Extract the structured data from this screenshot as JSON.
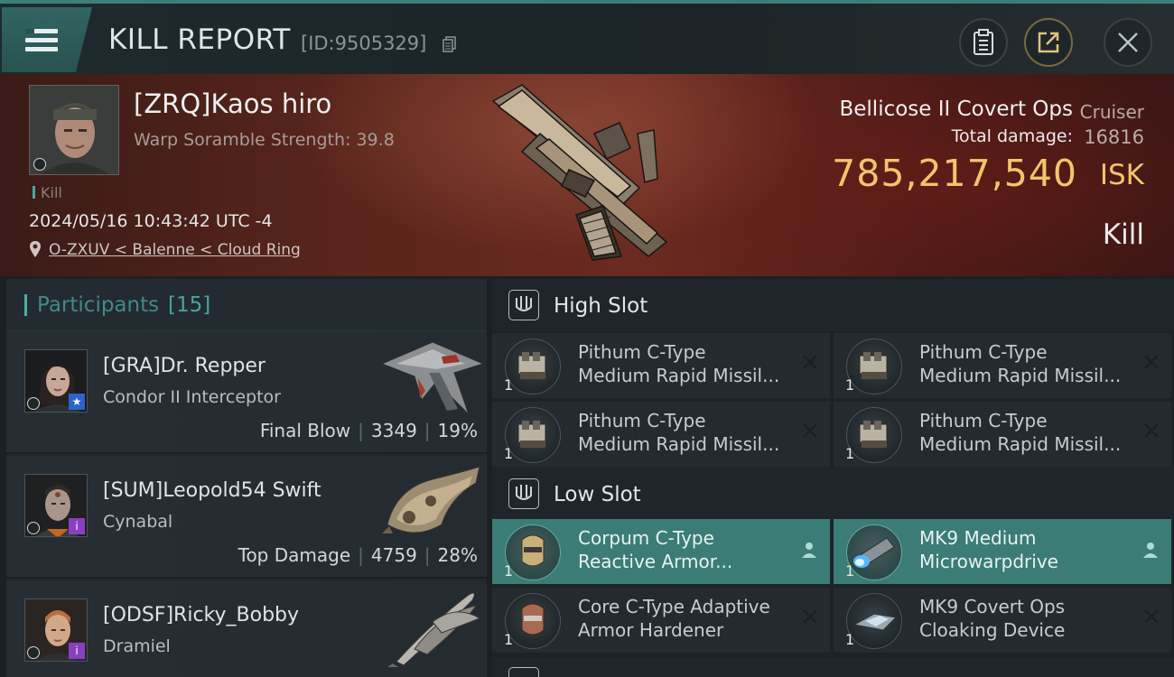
{
  "header": {
    "title": "KILL REPORT",
    "report_id": "[ID:9505329]"
  },
  "victim": {
    "name": "[ZRQ]Kaos hiro",
    "warp_scramble": "Warp Soramble Strength: 39.8",
    "tag": "Kill",
    "datetime": "2024/05/16 10:43:42 UTC -4",
    "location": "O-ZXUV < Balenne < Cloud Ring",
    "ship_name": "Bellicose II Covert Ops",
    "ship_class": "Cruiser",
    "total_damage_label": "Total damage:",
    "total_damage": "16816",
    "isk_value": "785,217,540",
    "isk_unit": "ISK",
    "result": "Kill"
  },
  "participants": {
    "title": "Participants",
    "count": "[15]",
    "items": [
      {
        "name": "[GRA]Dr. Repper",
        "ship": "Condor II Interceptor",
        "label": "Final Blow",
        "damage": "3349",
        "percent": "19%",
        "badge": "★"
      },
      {
        "name": "[SUM]Leopold54 Swift",
        "ship": "Cynabal",
        "label": "Top Damage",
        "damage": "4759",
        "percent": "28%",
        "badge": "i"
      },
      {
        "name": "[ODSF]Ricky_Bobby",
        "ship": "Dramiel",
        "badge": "i"
      }
    ]
  },
  "slots": {
    "high": {
      "title": "High Slot",
      "modules": [
        {
          "line1": "Pithum C-Type",
          "line2": "Medium Rapid Missil...",
          "qty": "1"
        },
        {
          "line1": "Pithum C-Type",
          "line2": "Medium Rapid Missil...",
          "qty": "1"
        },
        {
          "line1": "Pithum C-Type",
          "line2": "Medium Rapid Missil...",
          "qty": "1"
        },
        {
          "line1": "Pithum C-Type",
          "line2": "Medium Rapid Missil...",
          "qty": "1"
        }
      ]
    },
    "low": {
      "title": "Low Slot",
      "modules": [
        {
          "line1": "Corpum C-Type",
          "line2": "Reactive Armor...",
          "qty": "1"
        },
        {
          "line1": "MK9 Medium",
          "line2": "Microwarpdrive",
          "qty": "1"
        },
        {
          "line1": "Core C-Type Adaptive",
          "line2": " Armor Hardener",
          "qty": "1"
        },
        {
          "line1": "MK9 Covert Ops",
          "line2": "Cloaking Device",
          "qty": "1"
        }
      ]
    }
  },
  "colors": {
    "accent": "#3c7f7a",
    "isk": "#f3c46d",
    "active_module": "#3b7c76"
  }
}
